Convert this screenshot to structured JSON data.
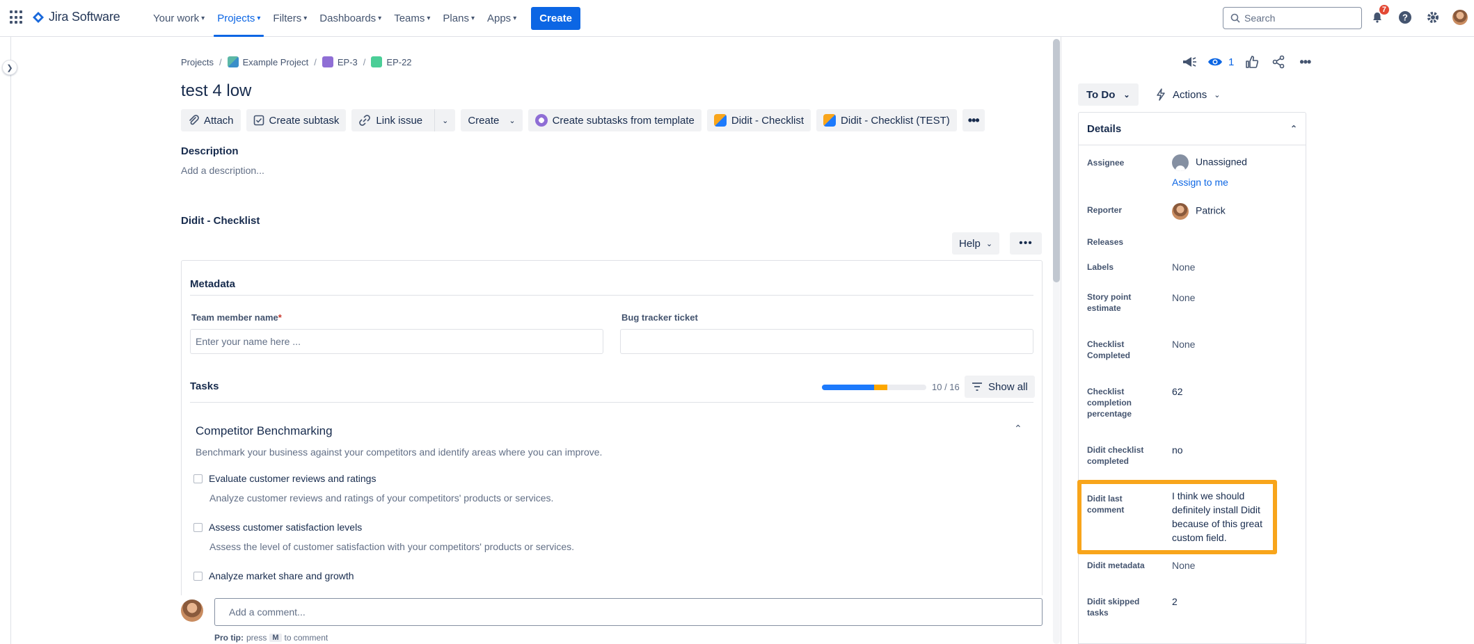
{
  "nav": {
    "product": "Jira Software",
    "items": [
      {
        "label": "Your work",
        "active": false
      },
      {
        "label": "Projects",
        "active": true
      },
      {
        "label": "Filters",
        "active": false
      },
      {
        "label": "Dashboards",
        "active": false
      },
      {
        "label": "Teams",
        "active": false
      },
      {
        "label": "Plans",
        "active": false
      },
      {
        "label": "Apps",
        "active": false
      }
    ],
    "create_label": "Create",
    "search_placeholder": "Search",
    "notifications_count": "7",
    "accent": "#0c66e4"
  },
  "breadcrumb": {
    "projects": "Projects",
    "project": "Example Project",
    "epic": "EP-3",
    "issue": "EP-22"
  },
  "issue": {
    "title": "test 4 low",
    "toolbar": {
      "attach": "Attach",
      "create_subtask": "Create subtask",
      "link_issue": "Link issue",
      "create": "Create",
      "create_from_template": "Create subtasks from template",
      "didit_checklist": "Didit - Checklist",
      "didit_checklist_test": "Didit - Checklist (TEST)"
    },
    "description_label": "Description",
    "description_placeholder": "Add a description..."
  },
  "checklist": {
    "section_title": "Didit - Checklist",
    "help_label": "Help",
    "metadata_title": "Metadata",
    "team_member_label": "Team member name",
    "required_mark": "*",
    "team_member_placeholder": "Enter your name here ...",
    "bug_tracker_label": "Bug tracker ticket",
    "bug_tracker_value": "",
    "tasks_title": "Tasks",
    "progress": {
      "completed_fraction": 0.5,
      "skipped_fraction": 0.125,
      "count": "10 / 16"
    },
    "show_all_label": "Show all",
    "group": {
      "title": "Competitor Benchmarking",
      "description": "Benchmark your business against your competitors and identify areas where you can improve.",
      "tasks": [
        {
          "label": "Evaluate customer reviews and ratings",
          "description": "Analyze customer reviews and ratings of your competitors' products or services."
        },
        {
          "label": "Assess customer satisfaction levels",
          "description": "Assess the level of customer satisfaction with your competitors' products or services."
        },
        {
          "label": "Analyze market share and growth",
          "description": ""
        }
      ]
    }
  },
  "comment": {
    "placeholder": "Add a comment...",
    "pro_tip_bold": "Pro tip:",
    "pro_tip_press": "press",
    "pro_tip_key": "M",
    "pro_tip_rest": "to comment"
  },
  "sidebar": {
    "watch_count": "1",
    "status": "To Do",
    "actions_label": "Actions",
    "details_title": "Details",
    "fields": {
      "assignee_label": "Assignee",
      "assignee_value": "Unassigned",
      "assign_to_me": "Assign to me",
      "reporter_label": "Reporter",
      "reporter_value": "Patrick",
      "releases_label": "Releases",
      "labels_label": "Labels",
      "labels_value": "None",
      "story_points_label": "Story point estimate",
      "story_points_value": "None",
      "checklist_completed_label": "Checklist Completed",
      "checklist_completed_value": "None",
      "checklist_pct_label": "Checklist completion percentage",
      "checklist_pct_value": "62",
      "didit_completed_label": "Didit checklist completed",
      "didit_completed_value": "no",
      "didit_last_comment_label": "Didit last comment",
      "didit_last_comment_value": "I think we should definitely install Didit because of this great custom field.",
      "didit_metadata_label": "Didit metadata",
      "didit_metadata_value": "None",
      "didit_skipped_label": "Didit skipped tasks",
      "didit_skipped_value": "2"
    },
    "highlight_color": "#f8a51b"
  }
}
